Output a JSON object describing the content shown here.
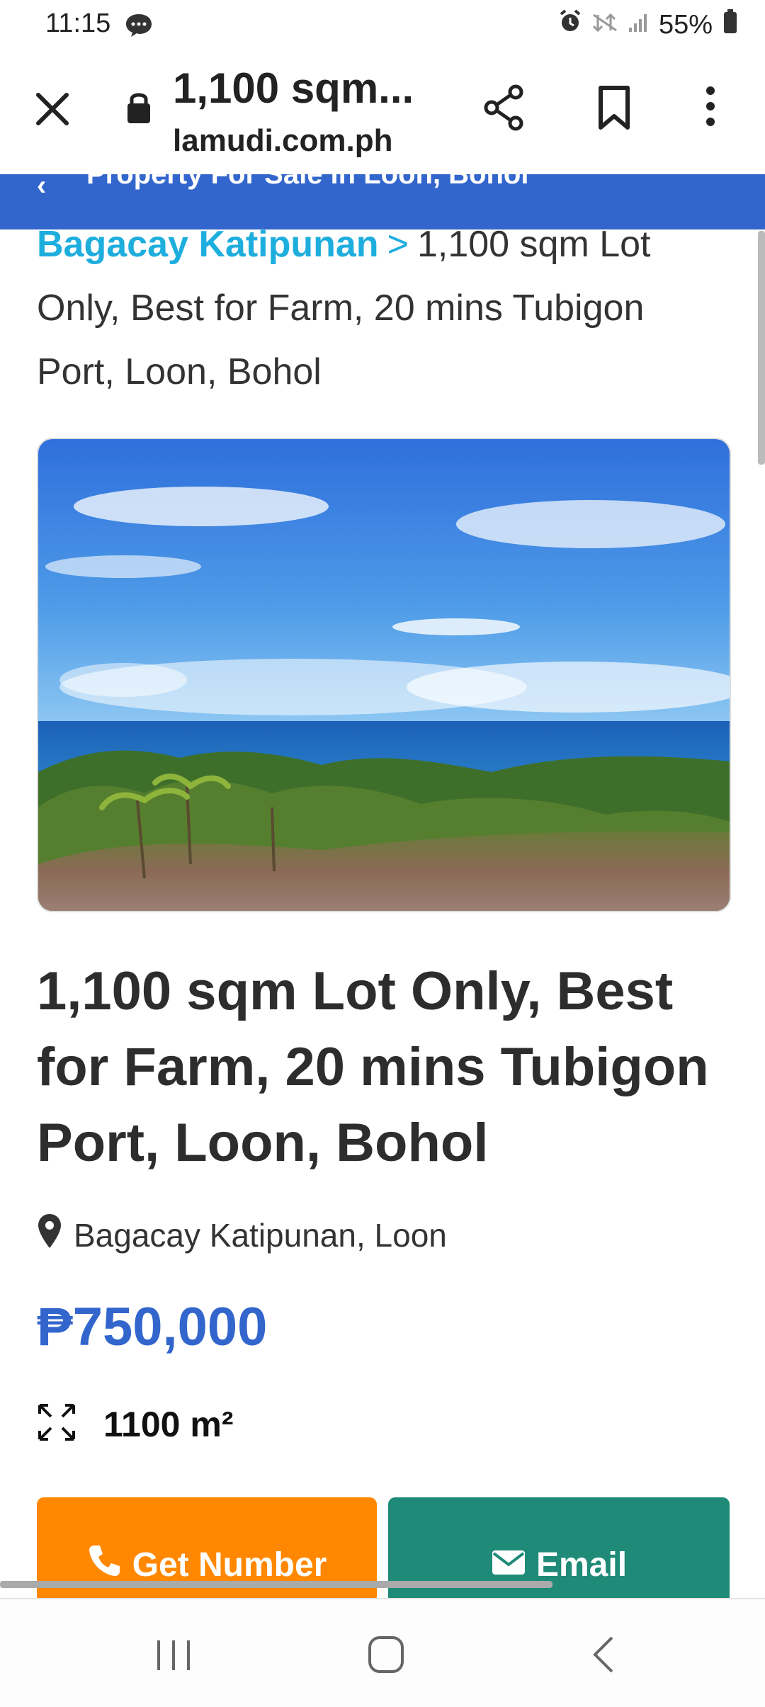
{
  "status_bar": {
    "time": "11:15",
    "battery": "55%",
    "icons": [
      "message-icon",
      "alarm-icon",
      "mobile-data-off-icon",
      "signal-icon",
      "battery-icon"
    ]
  },
  "browser": {
    "page_title": "1,100 sqm...",
    "url": "lamudi.com.ph",
    "icons": [
      "close-icon",
      "lock-icon",
      "share-icon",
      "bookmark-icon",
      "more-vert-icon"
    ]
  },
  "banner": {
    "text": "Property For Sale in Loon, Bohol"
  },
  "breadcrumb": {
    "link": "Bagacay Katipunan",
    "separator": ">",
    "current": "1,100 sqm Lot Only, Best for Farm, 20 mins Tubigon Port, Loon, Bohol"
  },
  "listing": {
    "title": "1,100 sqm Lot Only, Best for Farm, 20 mins Tubigon Port, Loon, Bohol",
    "location": "Bagacay Katipunan, Loon",
    "price": "₱750,000",
    "area": "1100 m²"
  },
  "actions": {
    "get_number": "Get Number",
    "email": "Email"
  },
  "colors": {
    "brand_blue": "#3366cc",
    "link_cyan": "#1eaede",
    "orange": "#ff8800",
    "teal": "#1e8a77"
  }
}
